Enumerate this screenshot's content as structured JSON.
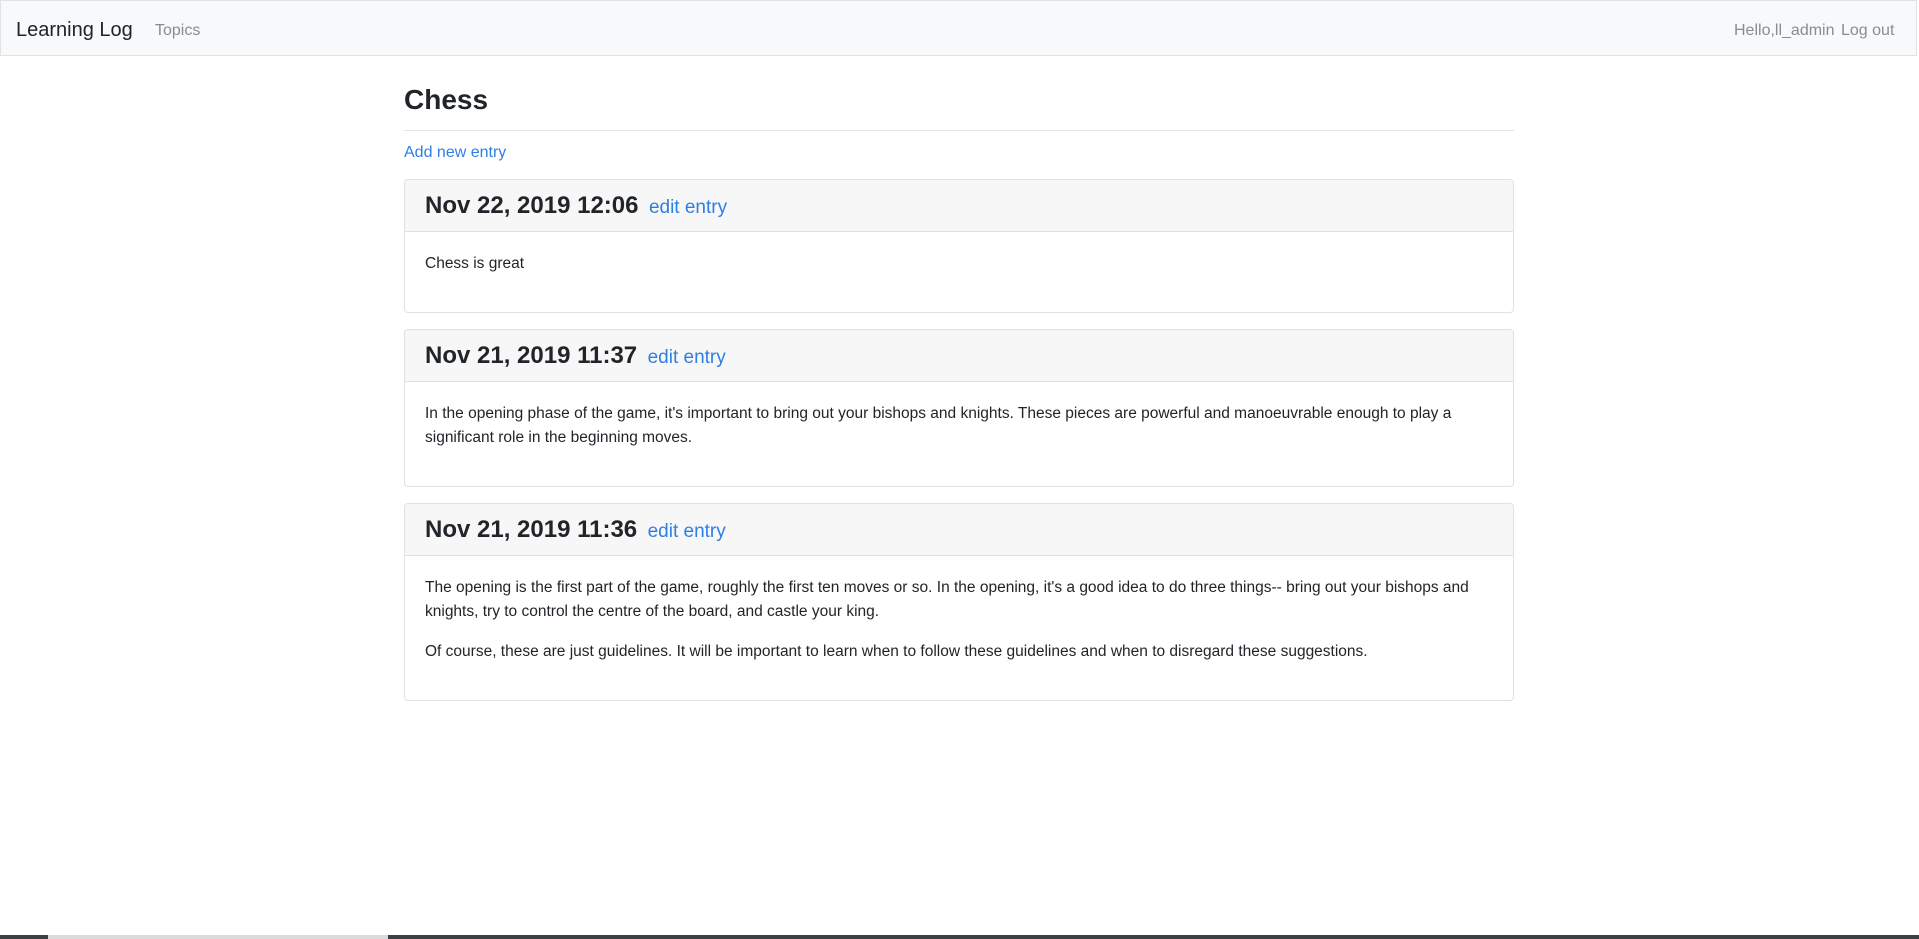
{
  "navbar": {
    "brand": "Learning Log",
    "topics_label": "Topics",
    "greeting": "Hello,ll_admin",
    "logout_label": "Log out"
  },
  "topic": {
    "title": "Chess",
    "add_entry_label": "Add new entry"
  },
  "entries": [
    {
      "date": "Nov 22, 2019 12:06",
      "edit_label": "edit entry",
      "paragraphs": [
        "Chess is great"
      ]
    },
    {
      "date": "Nov 21, 2019 11:37",
      "edit_label": "edit entry",
      "paragraphs": [
        "In the opening phase of the game, it's important to bring out your bishops and knights. These pieces are powerful and manoeuvrable enough to play a significant role in the beginning moves."
      ]
    },
    {
      "date": "Nov 21, 2019 11:36",
      "edit_label": "edit entry",
      "paragraphs": [
        "The opening is the first part of the game, roughly the first ten moves or so. In the opening, it's a good idea to do three things-- bring out your bishops and knights, try to control the centre of the board, and castle your king.",
        "Of course, these are just guidelines. It will be important to learn when to follow these guidelines and when to disregard these suggestions."
      ]
    }
  ],
  "colors": {
    "link": "#2f7fe3",
    "navbar_bg": "#f8f9fa",
    "card_header_bg": "#f7f7f7"
  }
}
